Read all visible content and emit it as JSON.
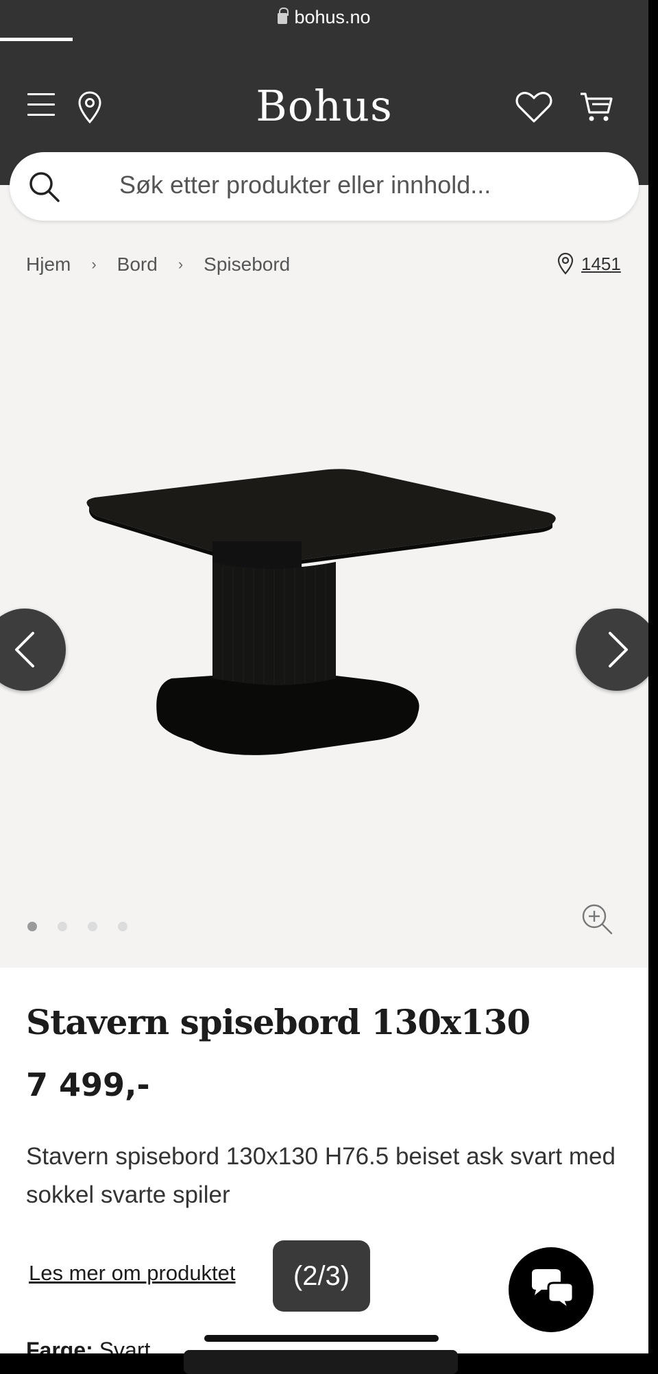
{
  "browser": {
    "url": "bohus.no"
  },
  "header": {
    "logo": "Bohus"
  },
  "search": {
    "placeholder": "Søk etter produkter eller innhold..."
  },
  "breadcrumb": {
    "items": [
      "Hjem",
      "Bord",
      "Spisebord"
    ]
  },
  "store": {
    "id": "1451"
  },
  "gallery": {
    "dot_count": 4,
    "active_index": 0
  },
  "product": {
    "title": "Stavern spisebord 130x130",
    "price": "7 499,-",
    "description": "Stavern spisebord 130x130 H76.5 beiset ask svart med sokkel svarte spiler",
    "read_more": "Les mer om produktet",
    "counter": "(2/3)",
    "color_label": "Farge:",
    "color_value": "Svart"
  },
  "colors": {
    "header_bg": "#333333",
    "page_bg": "#f4f3f2",
    "accent": "#1c1c1c"
  }
}
